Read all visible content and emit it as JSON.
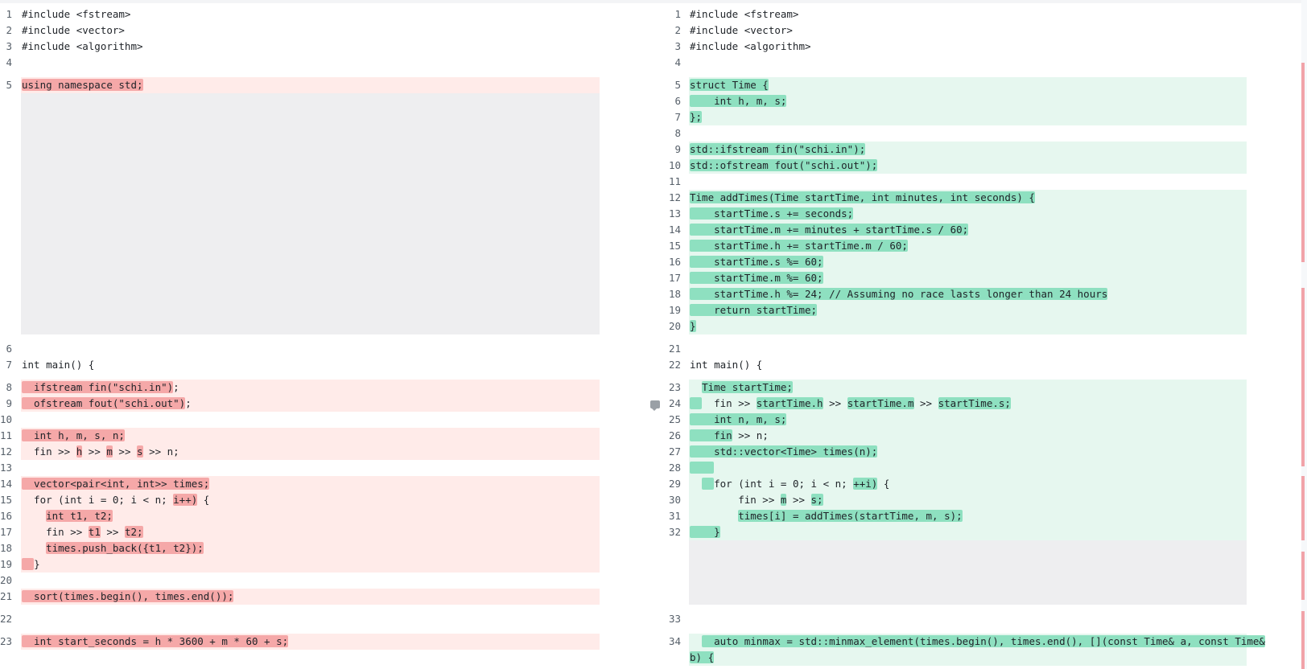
{
  "left": [
    {
      "n": "1",
      "t": "#include <fstream>",
      "k": "ctx"
    },
    {
      "n": "2",
      "t": "#include <vector>",
      "k": "ctx"
    },
    {
      "n": "3",
      "t": "#include <algorithm>",
      "k": "ctx"
    },
    {
      "n": "4",
      "t": "",
      "k": "ctx"
    },
    {
      "k": "gap"
    },
    {
      "n": "5",
      "t": "using namespace std;",
      "k": "del",
      "m": [
        [
          0,
          20
        ]
      ]
    },
    {
      "k": "filler",
      "rows": 15
    },
    {
      "k": "gap"
    },
    {
      "n": "6",
      "t": "",
      "k": "ctx"
    },
    {
      "n": "7",
      "t": "int main() {",
      "k": "ctx"
    },
    {
      "k": "gap"
    },
    {
      "n": "8",
      "t": "  ifstream fin(\"schi.in\");",
      "k": "del",
      "m": [
        [
          0,
          25
        ]
      ]
    },
    {
      "n": "9",
      "t": "  ofstream fout(\"schi.out\");",
      "k": "del",
      "m": [
        [
          0,
          27
        ]
      ]
    },
    {
      "n": "10",
      "t": "",
      "k": "del"
    },
    {
      "n": "11",
      "t": "  int h, m, s, n;",
      "k": "del",
      "m": [
        [
          0,
          17
        ]
      ]
    },
    {
      "n": "12",
      "t": "  fin >> h >> m >> s >> n;",
      "k": "del",
      "m": [
        [
          9,
          10
        ],
        [
          14,
          15
        ],
        [
          19,
          20
        ]
      ]
    },
    {
      "n": "13",
      "t": "",
      "k": "del"
    },
    {
      "n": "14",
      "t": "  vector<pair<int, int>> times;",
      "k": "del",
      "m": [
        [
          0,
          31
        ]
      ]
    },
    {
      "n": "15",
      "t": "  for (int i = 0; i < n; i++) {",
      "k": "del",
      "m": [
        [
          25,
          29
        ]
      ]
    },
    {
      "n": "16",
      "t": "    int t1, t2;",
      "k": "del",
      "m": [
        [
          4,
          15
        ]
      ]
    },
    {
      "n": "17",
      "t": "    fin >> t1 >> t2;",
      "k": "del",
      "m": [
        [
          11,
          13
        ],
        [
          17,
          20
        ]
      ]
    },
    {
      "n": "18",
      "t": "    times.push_back({t1, t2});",
      "k": "del",
      "m": [
        [
          4,
          30
        ]
      ]
    },
    {
      "n": "19",
      "t": "  }",
      "k": "del",
      "m": [
        [
          0,
          2
        ]
      ]
    },
    {
      "n": "20",
      "t": "",
      "k": "del"
    },
    {
      "n": "21",
      "t": "  sort(times.begin(), times.end());",
      "k": "del",
      "m": [
        [
          0,
          35
        ]
      ]
    },
    {
      "k": "gap"
    },
    {
      "n": "22",
      "t": "",
      "k": "ctx"
    },
    {
      "k": "gap"
    },
    {
      "n": "23",
      "t": "  int start_seconds = h * 3600 + m * 60 + s;",
      "k": "del",
      "m": [
        [
          0,
          44
        ]
      ]
    },
    {
      "n": "",
      "t": "",
      "k": "del"
    }
  ],
  "right": [
    {
      "n": "1",
      "t": "#include <fstream>",
      "k": "ctx"
    },
    {
      "n": "2",
      "t": "#include <vector>",
      "k": "ctx"
    },
    {
      "n": "3",
      "t": "#include <algorithm>",
      "k": "ctx"
    },
    {
      "n": "4",
      "t": "",
      "k": "ctx"
    },
    {
      "k": "gap"
    },
    {
      "n": "5",
      "t": "struct Time {",
      "k": "add",
      "m": [
        [
          0,
          13
        ]
      ]
    },
    {
      "n": "6",
      "t": "    int h, m, s;",
      "k": "add",
      "m": [
        [
          0,
          16
        ]
      ]
    },
    {
      "n": "7",
      "t": "};",
      "k": "add",
      "m": [
        [
          0,
          2
        ]
      ]
    },
    {
      "n": "8",
      "t": "",
      "k": "add"
    },
    {
      "n": "9",
      "t": "std::ifstream fin(\"schi.in\");",
      "k": "add",
      "m": [
        [
          0,
          29
        ]
      ]
    },
    {
      "n": "10",
      "t": "std::ofstream fout(\"schi.out\");",
      "k": "add",
      "m": [
        [
          0,
          31
        ]
      ]
    },
    {
      "n": "11",
      "t": "",
      "k": "add"
    },
    {
      "n": "12",
      "t": "Time addTimes(Time startTime, int minutes, int seconds) {",
      "k": "add",
      "m": [
        [
          0,
          58
        ]
      ]
    },
    {
      "n": "13",
      "t": "    startTime.s += seconds;",
      "k": "add",
      "m": [
        [
          0,
          27
        ]
      ]
    },
    {
      "n": "14",
      "t": "    startTime.m += minutes + startTime.s / 60;",
      "k": "add",
      "m": [
        [
          0,
          46
        ]
      ]
    },
    {
      "n": "15",
      "t": "    startTime.h += startTime.m / 60;",
      "k": "add",
      "m": [
        [
          0,
          36
        ]
      ]
    },
    {
      "n": "16",
      "t": "    startTime.s %= 60;",
      "k": "add",
      "m": [
        [
          0,
          22
        ]
      ]
    },
    {
      "n": "17",
      "t": "    startTime.m %= 60;",
      "k": "add",
      "m": [
        [
          0,
          22
        ]
      ]
    },
    {
      "n": "18",
      "t": "    startTime.h %= 24; // Assuming no race lasts longer than 24 hours",
      "k": "add",
      "m": [
        [
          0,
          69
        ]
      ]
    },
    {
      "n": "19",
      "t": "    return startTime;",
      "k": "add",
      "m": [
        [
          0,
          21
        ]
      ]
    },
    {
      "n": "20",
      "t": "}",
      "k": "add",
      "m": [
        [
          0,
          1
        ]
      ]
    },
    {
      "k": "gap"
    },
    {
      "n": "21",
      "t": "",
      "k": "ctx"
    },
    {
      "n": "22",
      "t": "int main() {",
      "k": "ctx"
    },
    {
      "k": "gap"
    },
    {
      "n": "23",
      "t": "  Time startTime;",
      "k": "add",
      "m": [
        [
          2,
          17
        ]
      ]
    },
    {
      "n": "24",
      "t": "    fin >> startTime.h >> startTime.m >> startTime.s;",
      "k": "add",
      "m": [
        [
          0,
          2
        ],
        [
          11,
          22
        ],
        [
          26,
          37
        ],
        [
          41,
          53
        ]
      ]
    },
    {
      "n": "25",
      "t": "    int n, m, s;",
      "k": "add",
      "m": [
        [
          0,
          16
        ]
      ]
    },
    {
      "n": "26",
      "t": "    fin >> n;",
      "k": "add",
      "m": [
        [
          0,
          7
        ]
      ]
    },
    {
      "n": "27",
      "t": "    std::vector<Time> times(n);",
      "k": "add",
      "m": [
        [
          0,
          31
        ]
      ]
    },
    {
      "n": "28",
      "t": "    ",
      "k": "add",
      "m": [
        [
          0,
          4
        ]
      ]
    },
    {
      "n": "29",
      "t": "    for (int i = 0; i < n; ++i) {",
      "k": "add",
      "m": [
        [
          2,
          4
        ],
        [
          27,
          31
        ]
      ]
    },
    {
      "n": "30",
      "t": "        fin >> m >> s;",
      "k": "add",
      "m": [
        [
          15,
          16
        ],
        [
          20,
          22
        ]
      ]
    },
    {
      "n": "31",
      "t": "        times[i] = addTimes(startTime, m, s);",
      "k": "add",
      "m": [
        [
          8,
          45
        ]
      ]
    },
    {
      "n": "32",
      "t": "    }",
      "k": "add",
      "m": [
        [
          0,
          5
        ]
      ]
    },
    {
      "k": "filler",
      "rows": 4
    },
    {
      "k": "gap"
    },
    {
      "n": "33",
      "t": "",
      "k": "ctx"
    },
    {
      "k": "gap"
    },
    {
      "n": "34",
      "t": "    auto minmax = std::minmax_element(times.begin(), times.end(), [](const Time& a, const Time&",
      "k": "add",
      "m": [
        [
          2,
          95
        ]
      ]
    },
    {
      "n": "",
      "t": "b) {",
      "k": "add",
      "m": [
        [
          0,
          4
        ]
      ]
    }
  ]
}
